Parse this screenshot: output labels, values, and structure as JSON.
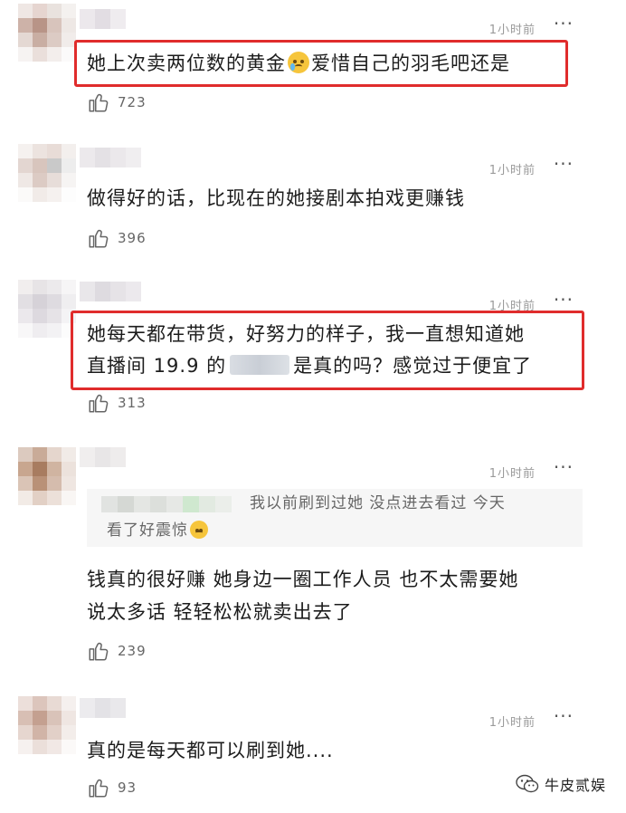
{
  "comments": [
    {
      "time": "1小时前",
      "more": "···",
      "text": "她上次卖两位数的黄金",
      "text_after": "爱惜自己的羽毛吧还是",
      "likes": "723"
    },
    {
      "time": "1小时前",
      "more": "···",
      "text": "做得好的话，比现在的她接剧本拍戏更赚钱",
      "likes": "396"
    },
    {
      "time": "1小时前",
      "more": "···",
      "line1": "她每天都在带货，好努力的样子，我一直想知道她",
      "line2_before": "直播间 19.9 的",
      "line2_after": "是真的吗？感觉过于便宜了",
      "likes": "313"
    },
    {
      "time": "1小时前",
      "more": "···",
      "reply_line1": "我以前刷到过她 没点进去看过 今天",
      "reply_line2": "看了好震惊",
      "line1": "钱真的很好赚 她身边一圈工作人员 也不太需要她",
      "line2": "说太多话 轻轻松松就卖出去了",
      "likes": "239"
    },
    {
      "time": "1小时前",
      "more": "···",
      "text": "真的是每天都可以刷到她....",
      "likes": "93"
    }
  ],
  "watermark": {
    "label": "牛皮贰娱"
  },
  "colors": {
    "highlight": "#e02c2c",
    "time": "#9a9a9a",
    "text": "#1c1c1c"
  }
}
